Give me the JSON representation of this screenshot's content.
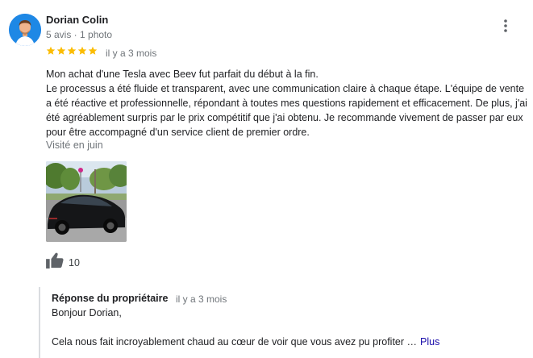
{
  "author": {
    "name": "Dorian Colin",
    "meta": "5 avis · 1 photo"
  },
  "review": {
    "rating": 5,
    "date": "il y a 3 mois",
    "paragraph1": "Mon achat d'une Tesla avec Beev fut parfait du début à la fin.",
    "paragraph2": "Le processus a été fluide et transparent, avec une communication claire à chaque étape. L'équipe de vente a été réactive et professionnelle, répondant à toutes mes questions rapidement et efficacement. De plus, j'ai été agréablement surpris par le prix compétitif que j'ai obtenu. Je recommande vivement de passer par eux pour être accompagné d'un service client de premier ordre.",
    "visited": "Visité en juin",
    "likes": "10"
  },
  "owner_reply": {
    "title": "Réponse du propriétaire",
    "date": "il y a 3 mois",
    "greeting": "Bonjour Dorian,",
    "body": "Cela nous fait incroyablement chaud au cœur de voir que vous avez pu profiter …",
    "more_label": "Plus"
  },
  "colors": {
    "star": "#fbbc04",
    "link": "#1a0dab",
    "muted": "#70757a"
  }
}
